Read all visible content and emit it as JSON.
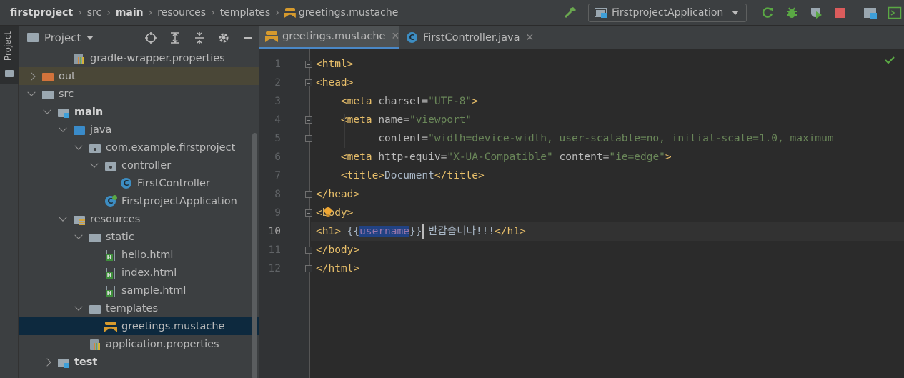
{
  "breadcrumbs": {
    "items": [
      "firstproject",
      "src",
      "main",
      "resources",
      "templates"
    ],
    "file": "greetings.mustache"
  },
  "toolbar": {
    "run_config": "FirstprojectApplication",
    "icons": [
      "hammer-icon",
      "rerun-icon",
      "debug-icon",
      "coverage-icon",
      "stop-icon",
      "project-structure-icon",
      "terminal-icon"
    ]
  },
  "side_stripe": {
    "project_tab": "Project"
  },
  "project_panel": {
    "title": "Project",
    "tree": [
      {
        "label": "gradle-wrapper.properties",
        "depth": 3,
        "arrow": "none",
        "icon": "props"
      },
      {
        "label": "out",
        "depth": 1,
        "arrow": "closed",
        "icon": "folder-orange",
        "excluded": true
      },
      {
        "label": "src",
        "depth": 1,
        "arrow": "open",
        "icon": "folder"
      },
      {
        "label": "main",
        "depth": 2,
        "arrow": "open",
        "icon": "folder-src",
        "bold": true
      },
      {
        "label": "java",
        "depth": 3,
        "arrow": "open",
        "icon": "folder-blue"
      },
      {
        "label": "com.example.firstproject",
        "depth": 4,
        "arrow": "open",
        "icon": "pkg"
      },
      {
        "label": "controller",
        "depth": 5,
        "arrow": "open",
        "icon": "pkg"
      },
      {
        "label": "FirstController",
        "depth": 6,
        "arrow": "none",
        "icon": "cls"
      },
      {
        "label": "FirstprojectApplication",
        "depth": 5,
        "arrow": "none",
        "icon": "cls-app"
      },
      {
        "label": "resources",
        "depth": 3,
        "arrow": "open",
        "icon": "res"
      },
      {
        "label": "static",
        "depth": 4,
        "arrow": "open",
        "icon": "folder"
      },
      {
        "label": "hello.html",
        "depth": 5,
        "arrow": "none",
        "icon": "html"
      },
      {
        "label": "index.html",
        "depth": 5,
        "arrow": "none",
        "icon": "html"
      },
      {
        "label": "sample.html",
        "depth": 5,
        "arrow": "none",
        "icon": "html"
      },
      {
        "label": "templates",
        "depth": 4,
        "arrow": "open",
        "icon": "folder"
      },
      {
        "label": "greetings.mustache",
        "depth": 5,
        "arrow": "none",
        "icon": "mus",
        "selected": true
      },
      {
        "label": "application.properties",
        "depth": 4,
        "arrow": "none",
        "icon": "props"
      },
      {
        "label": "test",
        "depth": 2,
        "arrow": "closed",
        "icon": "folder-src",
        "bold": true
      }
    ]
  },
  "editor": {
    "tabs": [
      {
        "label": "greetings.mustache",
        "active": true
      },
      {
        "label": "FirstController.java",
        "active": false
      }
    ],
    "current_line": 10,
    "line_numbers": [
      "1",
      "2",
      "3",
      "4",
      "5",
      "6",
      "7",
      "8",
      "9",
      "10",
      "11",
      "12"
    ],
    "lines": [
      "<html>",
      "<head>",
      "    <meta charset=\"UTF-8\">",
      "    <meta name=\"viewport\"",
      "          content=\"width=device-width, user-scalable=no, initial-scale=1.0, maximum",
      "    <meta http-equiv=\"X-UA-Compatible\" content=\"ie=edge\">",
      "    <title>Document</title>",
      "</head>",
      "<body>",
      "<h1> {{username}} 반갑습니다!!!</h1>",
      "</body>",
      "</html>"
    ]
  }
}
